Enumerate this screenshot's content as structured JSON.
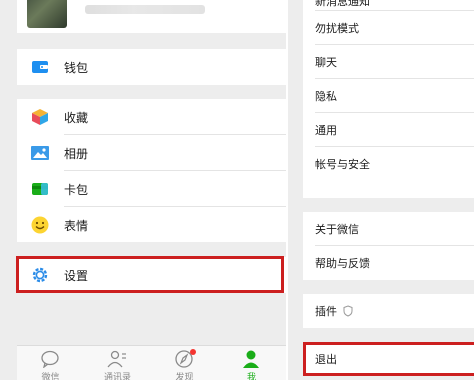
{
  "left": {
    "wallet": {
      "label": "钱包",
      "icon": "wallet-icon"
    },
    "items": [
      {
        "label": "收藏",
        "icon": "favorites-cube-icon"
      },
      {
        "label": "相册",
        "icon": "album-picture-icon"
      },
      {
        "label": "卡包",
        "icon": "card-pack-icon"
      },
      {
        "label": "表情",
        "icon": "emoji-smile-icon"
      }
    ],
    "settings": {
      "label": "设置",
      "icon": "settings-gear-icon"
    },
    "tabs": [
      {
        "label": "微信",
        "icon": "chat-bubble-icon"
      },
      {
        "label": "通讯录",
        "icon": "contacts-icon"
      },
      {
        "label": "发现",
        "icon": "discover-compass-icon"
      },
      {
        "label": "我",
        "icon": "me-person-icon"
      }
    ]
  },
  "right": {
    "group1": [
      "新消息通知",
      "勿扰模式",
      "聊天",
      "隐私",
      "通用",
      "帐号与安全"
    ],
    "group2": [
      "关于微信",
      "帮助与反馈"
    ],
    "plugins": "插件",
    "logout": "退出"
  },
  "colors": {
    "accent": "#1aad19",
    "highlight": "#cc1f1f",
    "badge": "#f43530"
  }
}
